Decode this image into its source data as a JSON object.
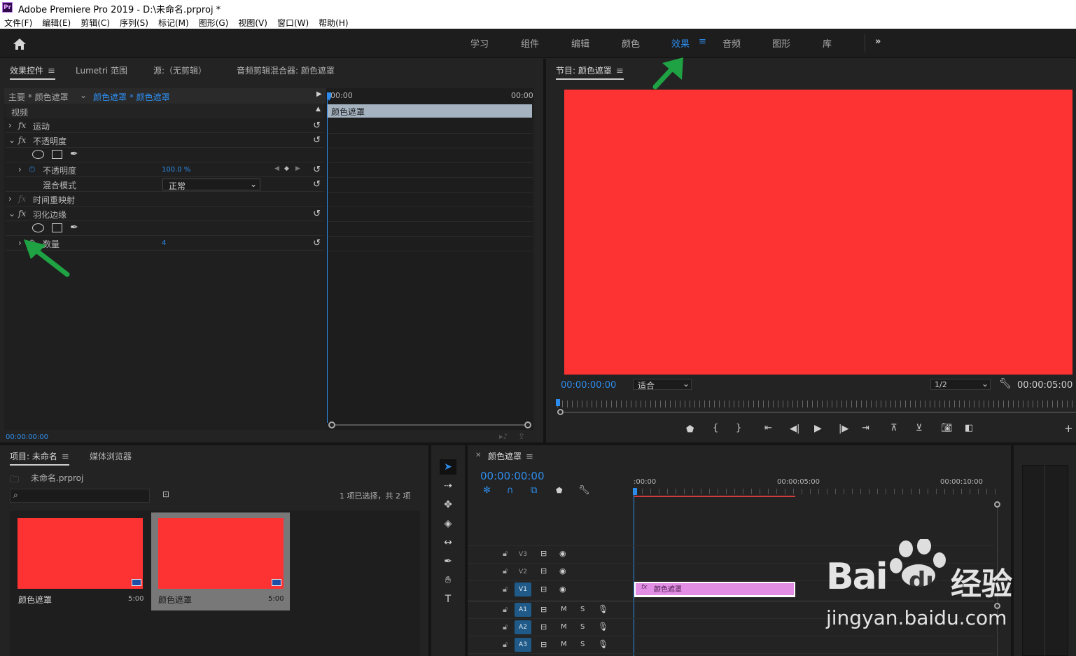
{
  "window": {
    "title": "Adobe Premiere Pro 2019 - D:\\未命名.prproj *",
    "app_icon": "Pr"
  },
  "menu": [
    "文件(F)",
    "编辑(E)",
    "剪辑(C)",
    "序列(S)",
    "标记(M)",
    "图形(G)",
    "视图(V)",
    "窗口(W)",
    "帮助(H)"
  ],
  "workspaces": [
    {
      "label": "学习",
      "active": false
    },
    {
      "label": "组件",
      "active": false
    },
    {
      "label": "编辑",
      "active": false
    },
    {
      "label": "颜色",
      "active": false
    },
    {
      "label": "效果",
      "active": true
    },
    {
      "label": "音频",
      "active": false
    },
    {
      "label": "图形",
      "active": false
    },
    {
      "label": "库",
      "active": false
    }
  ],
  "effect_controls": {
    "tabs": [
      "效果控件",
      "Lumetri 范围",
      "源:（无剪辑）",
      "音频剪辑混合器: 颜色遮罩"
    ],
    "master_label": "主要 * 颜色遮罩",
    "clip_label": "颜色遮罩 * 颜色遮罩",
    "time_start": "00:00",
    "time_end": "00:00",
    "clip_bar": "颜色遮罩",
    "section_video": "视频",
    "rows": {
      "motion": "运动",
      "opacity": "不透明度",
      "opacity_param": "不透明度",
      "opacity_value": "100.0 %",
      "blend_mode": "混合模式",
      "blend_value": "正常",
      "time_remap": "时间重映射",
      "feather": "羽化边缘",
      "amount": "数量",
      "amount_value": "4"
    },
    "timecode": "00:00:00:00"
  },
  "program": {
    "title": "节目: 颜色遮罩",
    "timecode": "00:00:00:00",
    "fit": "适合",
    "resolution": "1/2",
    "duration": "00:00:05:00",
    "frame_color": "#fd3233"
  },
  "project": {
    "tabs": [
      "项目: 未命名",
      "媒体浏览器"
    ],
    "file": "未命名.prproj",
    "selection": "1 项已选择，共 2 项",
    "items": [
      {
        "name": "颜色遮罩",
        "duration": "5:00"
      },
      {
        "name": "颜色遮罩",
        "duration": "5:00"
      }
    ]
  },
  "timeline": {
    "title": "颜色遮罩",
    "timecode": "00:00:00:00",
    "ruler": [
      ":00:00",
      "00:00:05:00",
      "00:00:10:00"
    ],
    "tracks_video": [
      "V3",
      "V2",
      "V1"
    ],
    "tracks_audio": [
      "A1",
      "A2",
      "A3"
    ],
    "mute": "M",
    "solo": "S",
    "clip_label": "颜色遮罩",
    "clip_color": "#e18ee4"
  },
  "watermark": {
    "brand": "Bai",
    "brand2": "du",
    "cn": "经验",
    "url": "jingyan.baidu.com"
  },
  "accent_color": "#2d8ceb",
  "annotation_color": "#1fa243"
}
